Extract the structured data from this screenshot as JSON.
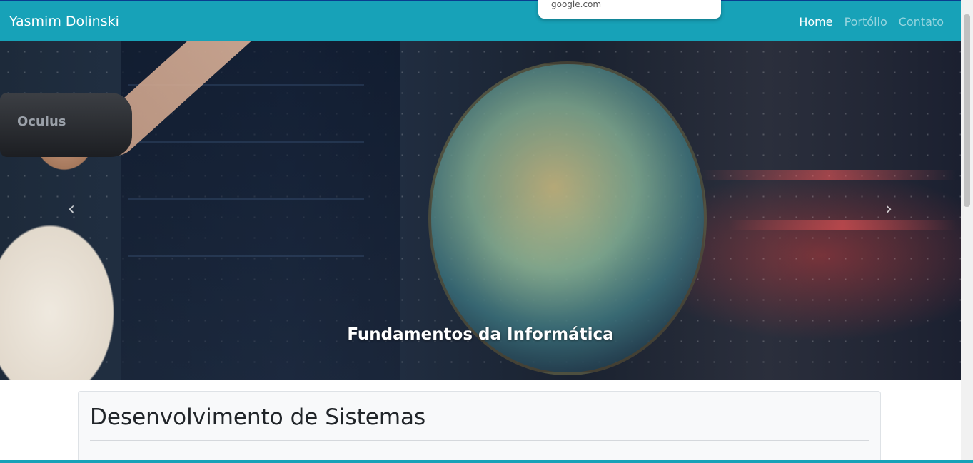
{
  "navbar": {
    "brand": "Yasmim Dolinski",
    "links": [
      {
        "label": "Home"
      },
      {
        "label": "Portólio"
      },
      {
        "label": "Contato"
      }
    ]
  },
  "tooltip": {
    "url": "google.com"
  },
  "carousel": {
    "caption": "Fundamentos da Informática",
    "headset_label": "Oculus",
    "prev_glyph": "‹",
    "next_glyph": "›"
  },
  "card": {
    "title": "Desenvolvimento de Sistemas"
  },
  "colors": {
    "navbar": "#17a2b8",
    "card_bg": "#f8f9fa"
  }
}
